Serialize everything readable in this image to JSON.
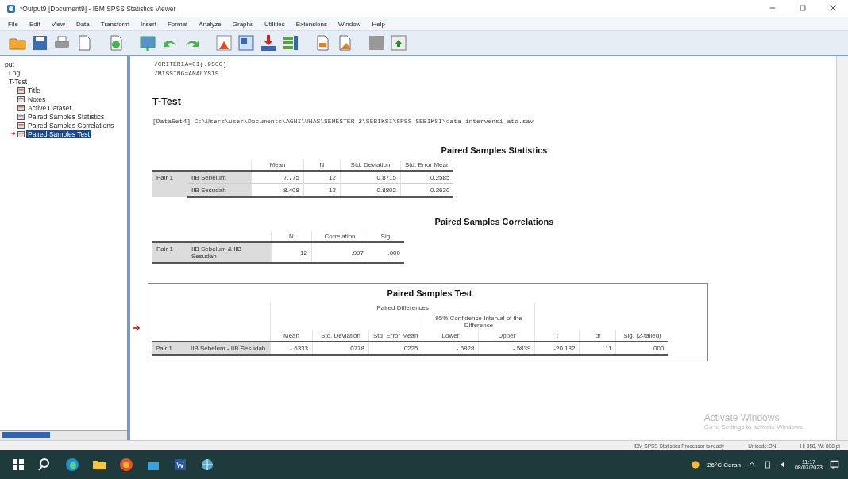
{
  "window": {
    "title": "*Output9 [Document9] - IBM SPSS Statistics Viewer"
  },
  "menu": [
    "File",
    "Edit",
    "View",
    "Data",
    "Transform",
    "Insert",
    "Format",
    "Analyze",
    "Graphs",
    "Utilities",
    "Extensions",
    "Window",
    "Help"
  ],
  "outline": [
    {
      "label": "put",
      "selected": false,
      "children": [
        {
          "label": "Log",
          "selected": false
        },
        {
          "label": "T-Test",
          "selected": false,
          "children": [
            {
              "label": "Title",
              "selected": false
            },
            {
              "label": "Notes",
              "selected": false
            },
            {
              "label": "Active Dataset",
              "selected": false
            },
            {
              "label": "Paired Samples Statistics",
              "selected": false
            },
            {
              "label": "Paired Samples Correlations",
              "selected": false
            },
            {
              "label": "Paired Samples Test",
              "selected": true
            }
          ]
        }
      ]
    }
  ],
  "syntax_lines": [
    "/CRITERIA=CI(.9500)",
    "/MISSING=ANALYSIS."
  ],
  "heading": "T-Test",
  "dataset_line": "[DataSet4] C:\\Users\\user\\Documents\\AGNI\\UNAS\\SEMESTER 2\\SEBIKSI\\SPSS SEBIKSI\\data intervensi ato.sav",
  "statistics": {
    "title": "Paired Samples Statistics",
    "columns": [
      "Mean",
      "N",
      "Std. Deviation",
      "Std. Error Mean"
    ],
    "rows": [
      {
        "pair": "Pair 1",
        "label": "IIB Sebelum",
        "cells": [
          "7.775",
          "12",
          "0.8715",
          "0.2585"
        ]
      },
      {
        "pair": "",
        "label": "IIB Sesudah",
        "cells": [
          "8.408",
          "12",
          "0.8802",
          "0.2630"
        ]
      }
    ]
  },
  "correlations": {
    "title": "Paired Samples Correlations",
    "columns": [
      "N",
      "Correlation",
      "Sig."
    ],
    "rows": [
      {
        "pair": "Pair 1",
        "label": "IIB Sebelum & IIB Sesudah",
        "cells": [
          "12",
          ".997",
          ".000"
        ]
      }
    ]
  },
  "test": {
    "title": "Paired Samples Test",
    "group_header": "Paired Differences",
    "ci_header": "95% Confidence Interval of the Difference",
    "columns": [
      "Mean",
      "Std. Deviation",
      "Std. Error Mean",
      "Lower",
      "Upper",
      "t",
      "df",
      "Sig. (2-tailed)"
    ],
    "rows": [
      {
        "pair": "Pair 1",
        "label": "IIB Sebelum - IIB Sesudah",
        "cells": [
          "-.6333",
          ".0778",
          ".0225",
          "-.6828",
          "-.5839",
          "-20.182",
          "11",
          ".000"
        ]
      }
    ]
  },
  "activation": {
    "title": "Activate Windows",
    "subtitle": "Go to Settings to activate Windows."
  },
  "status_bar": [
    "IBM SPSS Statistics Processor is ready",
    "Unicode:ON",
    "H: 358, W: 808 pt"
  ],
  "taskbar": {
    "weather": "26°C Cerah",
    "time": "11:17",
    "date": "08/07/2023"
  }
}
